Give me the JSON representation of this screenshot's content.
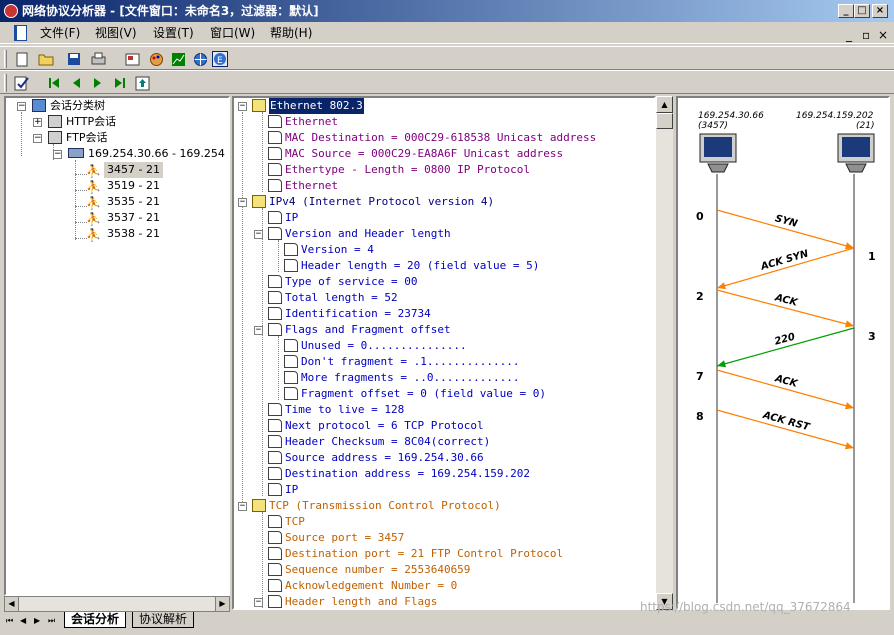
{
  "window": {
    "title": "网络协议分析器 - [文件窗口：未命名3，过滤器：默认]",
    "min": "_",
    "max": "□",
    "close": "×",
    "child_min": "_",
    "child_restore": "▫",
    "child_close": "×"
  },
  "menu": [
    "文件(F)",
    "视图(V)",
    "设置(T)",
    "窗口(W)",
    "帮助(H)"
  ],
  "left_tree": {
    "root": "会话分类树",
    "http": "HTTP会话",
    "ftp": "FTP会话",
    "conn": "169.254.30.66 - 169.254",
    "ports": [
      "3457 - 21",
      "3519 - 21",
      "3535 - 21",
      "3537 - 21",
      "3538 - 21"
    ]
  },
  "proto_tree": {
    "ethernet": {
      "header": "Ethernet 802.3",
      "items": [
        "Ethernet",
        "MAC Destination = 000C29-618538 Unicast address",
        "MAC Source = 000C29-EA8A6F Unicast address",
        "Ethertype - Length = 0800 IP Protocol",
        "Ethernet"
      ]
    },
    "ipv4": {
      "header": "IPv4 (Internet Protocol version 4)",
      "ip": "IP",
      "vhl": "Version and Header length",
      "version": "Version = 4",
      "hlen": "Header length = 20 (field value = 5)",
      "tos": "Type of service = 00",
      "total": "Total length = 52",
      "ident": "Identification = 23734",
      "flags": "Flags and Fragment offset",
      "unused": "Unused = 0...............",
      "df": "Don't fragment = .1..............",
      "mf": "More fragments = ..0.............",
      "fo": "Fragment offset = 0 (field value = 0)",
      "ttl": "Time to live = 128",
      "next": "Next protocol = 6 TCP Protocol",
      "checksum": "Header Checksum = 8C04(correct)",
      "src": "Source address = 169.254.30.66",
      "dst": "Destination address = 169.254.159.202",
      "ip_end": "IP"
    },
    "tcp": {
      "header": "TCP (Transmission Control Protocol)",
      "tcp": "TCP",
      "sport": "Source port = 3457",
      "dport": "Destination port = 21 FTP Control Protocol",
      "seq": "Sequence number = 2553640659",
      "ack": "Acknowledgement Number = 0",
      "hlf": "Header length and Flags"
    }
  },
  "sequence": {
    "host_a": {
      "ip": "169.254.30.66",
      "port": "(3457)"
    },
    "host_b": {
      "ip": "169.254.159.202",
      "port": "(21)"
    },
    "steps": [
      {
        "num": "0",
        "label": "SYN",
        "color": "#ff7f00"
      },
      {
        "num": "1",
        "label": "ACK SYN",
        "color": "#ff7f00"
      },
      {
        "num": "2",
        "label": "ACK",
        "color": "#ff7f00"
      },
      {
        "num": "3",
        "label": "220",
        "color": "#00a000"
      },
      {
        "num": "7",
        "label": "ACK",
        "color": "#ff7f00"
      },
      {
        "num": "8",
        "label": "ACK RST",
        "color": "#ff7f00"
      }
    ]
  },
  "bottom_tabs": [
    "会话分析",
    "协议解析"
  ],
  "watermark": "https://blog.csdn.net/qq_37672864",
  "colors": {
    "header_blue": "#000080",
    "field_purple": "#800080",
    "field_blue": "#0000c0",
    "field_orange": "#c06000"
  }
}
